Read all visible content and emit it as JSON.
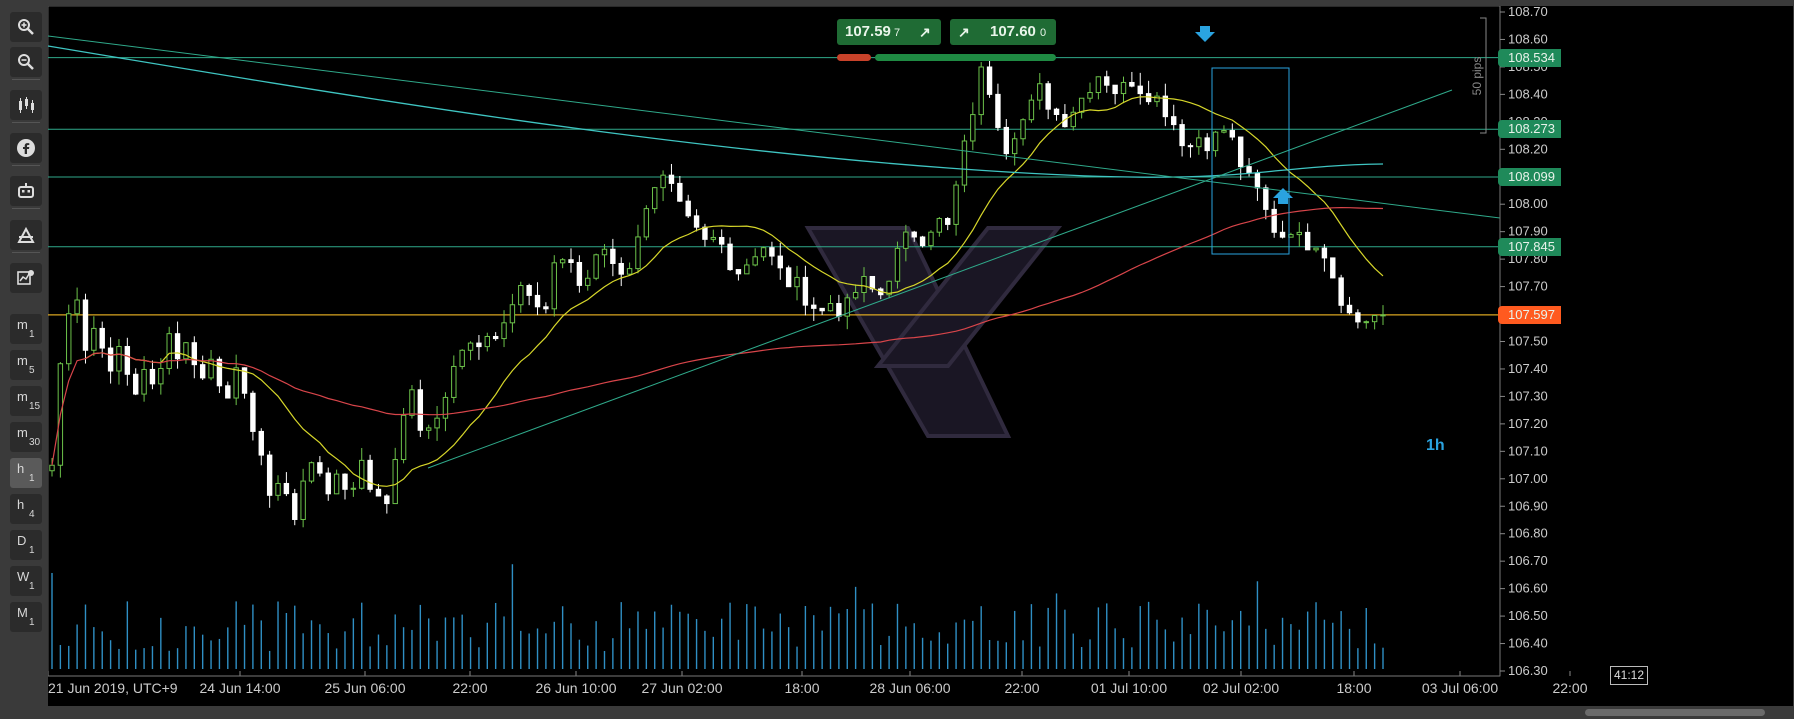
{
  "toolbar": {
    "buttons": [
      "zoom-in",
      "zoom-out",
      "candles",
      "facebook",
      "bot",
      "trader",
      "settings"
    ],
    "timeframes": [
      {
        "l": "m",
        "n": "1"
      },
      {
        "l": "m",
        "n": "5"
      },
      {
        "l": "m",
        "n": "15"
      },
      {
        "l": "m",
        "n": "30"
      },
      {
        "l": "h",
        "n": "1",
        "active": true
      },
      {
        "l": "h",
        "n": "4"
      },
      {
        "l": "D",
        "n": "1"
      },
      {
        "l": "W",
        "n": "1"
      },
      {
        "l": "M",
        "n": "1"
      }
    ]
  },
  "quote": {
    "bid_main": "107.59",
    "bid_small": "7",
    "ask_main": "107.60",
    "ask_small": "0"
  },
  "timeframe_label": "1h",
  "timer": "41:12",
  "pips_label": "50 pips",
  "colors": {
    "bull": "#6cc24a",
    "bear": "#ffffff",
    "ma_yellow": "#d6d62a",
    "ma_red": "#d8454a",
    "ma_cyan": "#3fc5c2",
    "hline": "#2fa98a",
    "price": "#ff5a1f",
    "volume": "#2f8fc4",
    "box": "#2aa3e0"
  },
  "chart_data": {
    "type": "candlestick",
    "symbol_timeframe": "1h",
    "ylim": [
      106.3,
      108.7
    ],
    "yticks": [
      "108.70",
      "108.60",
      "108.50",
      "108.40",
      "108.30",
      "108.20",
      "108.10",
      "108.00",
      "107.90",
      "107.80",
      "107.70",
      "107.60",
      "107.50",
      "107.40",
      "107.30",
      "107.20",
      "107.10",
      "107.00",
      "106.90",
      "106.80",
      "106.70",
      "106.60",
      "106.50",
      "106.40",
      "106.30"
    ],
    "xticks": [
      "21 Jun 2019, UTC+9",
      "24 Jun 14:00",
      "25 Jun 06:00",
      "22:00",
      "26 Jun 10:00",
      "27 Jun 02:00",
      "18:00",
      "28 Jun 06:00",
      "22:00",
      "01 Jul 10:00",
      "02 Jul 02:00",
      "18:00",
      "03 Jul 06:00",
      "22:00"
    ],
    "hlines": [
      108.534,
      108.273,
      108.099,
      107.845
    ],
    "current_price": 107.597,
    "candle_count": 160,
    "path": [
      107.05,
      107.55,
      107.72,
      107.45,
      107.6,
      107.35,
      107.5,
      107.3,
      107.38,
      107.32,
      107.55,
      107.45,
      107.5,
      107.35,
      107.45,
      107.3,
      107.38,
      107.25,
      107.15,
      106.9,
      107.05,
      106.82,
      107.0,
      107.12,
      106.9,
      107.05,
      106.92,
      107.08,
      106.95,
      106.88,
      107.1,
      107.35,
      107.2,
      107.15,
      107.28,
      107.4,
      107.5,
      107.45,
      107.55,
      107.52,
      107.65,
      107.75,
      107.62,
      107.6,
      107.8,
      107.82,
      107.7,
      107.75,
      107.85,
      107.78,
      107.75,
      107.85,
      108.05,
      108.1,
      108.05,
      107.95,
      107.9,
      107.85,
      107.88,
      107.8,
      107.75,
      107.82,
      107.85,
      107.78,
      107.72,
      107.7,
      107.65,
      107.6,
      107.65,
      107.6,
      107.68,
      107.72,
      107.65,
      107.75,
      107.85,
      107.9,
      107.88,
      107.95,
      107.9,
      108.1,
      108.3,
      108.48,
      108.4,
      108.2,
      108.28,
      108.32,
      108.42,
      108.36,
      108.3,
      108.35,
      108.4,
      108.48,
      108.45,
      108.4,
      108.46,
      108.42,
      108.4,
      108.35,
      108.28,
      108.2,
      108.25,
      108.22,
      108.28,
      108.22,
      108.1,
      108.05,
      107.95,
      107.88,
      107.92,
      107.85,
      107.88,
      107.82,
      107.7,
      107.6,
      107.57,
      107.59,
      107.597
    ],
    "volume_note": "hourly tick volume bars"
  }
}
